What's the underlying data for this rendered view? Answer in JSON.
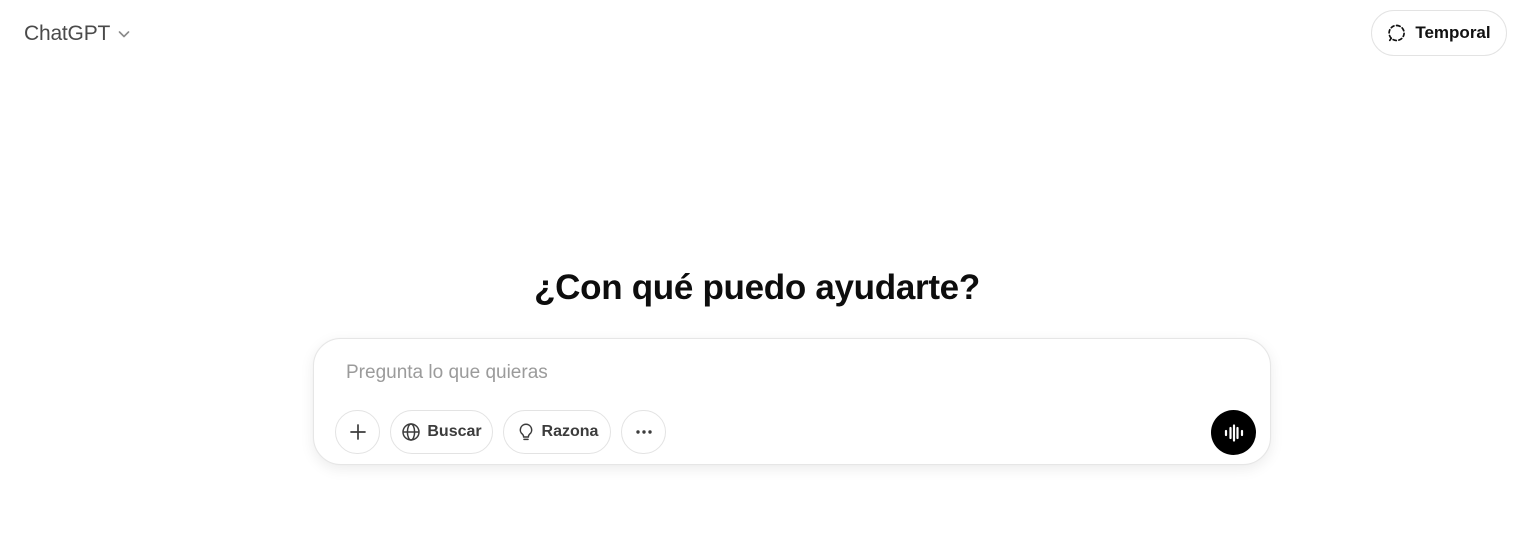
{
  "header": {
    "model_name": "ChatGPT",
    "temporary_label": "Temporal"
  },
  "hero": {
    "title": "¿Con qué puedo ayudarte?"
  },
  "composer": {
    "placeholder": "Pregunta lo que quieras",
    "value": "",
    "tools": {
      "search_label": "Buscar",
      "reason_label": "Razona"
    }
  },
  "icons": {
    "model_dropdown": "chevron-down-icon",
    "temporary": "dashed-chat-bubble-icon",
    "attach": "plus-icon",
    "search": "globe-icon",
    "reason": "lightbulb-icon",
    "more": "more-horizontal-icon",
    "voice": "voice-waveform-icon"
  },
  "colors": {
    "background": "#ffffff",
    "voice_button": "#000000",
    "placeholder_text": "#9b9b9b"
  }
}
